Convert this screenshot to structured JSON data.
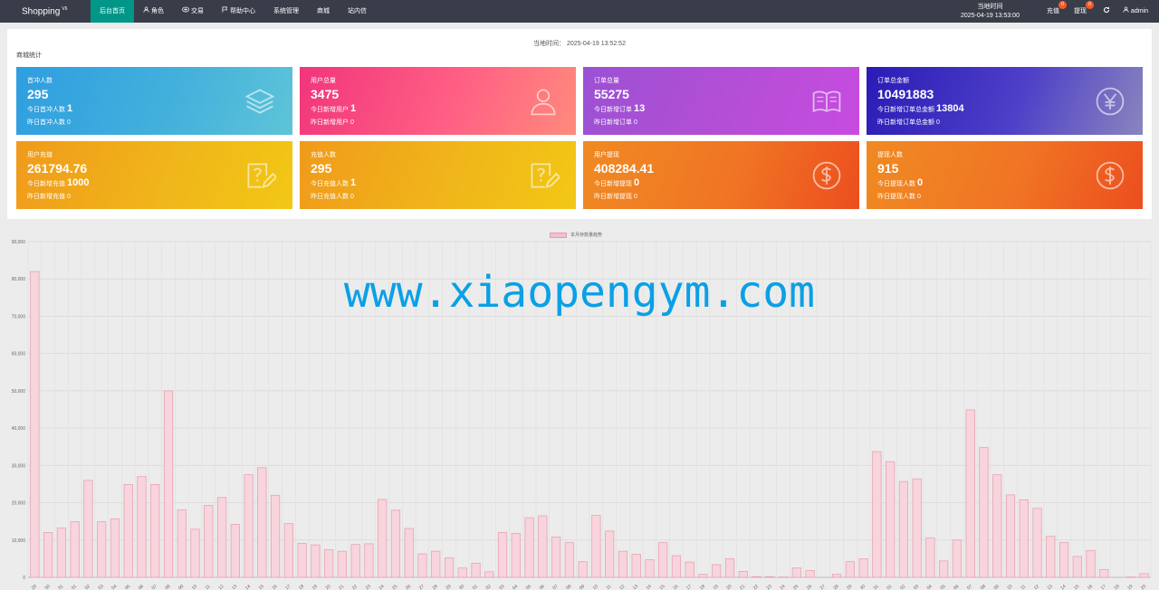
{
  "brand": {
    "name": "Shopping",
    "version": "V6"
  },
  "nav": [
    {
      "label": "后台首页",
      "icon": "",
      "active": true
    },
    {
      "label": "角色",
      "icon": "user-icon"
    },
    {
      "label": "交易",
      "icon": "transaction-icon"
    },
    {
      "label": "帮助中心",
      "icon": "flag-icon"
    },
    {
      "label": "系统管理",
      "icon": ""
    },
    {
      "label": "商城",
      "icon": ""
    },
    {
      "label": "站内信",
      "icon": ""
    }
  ],
  "header_right": {
    "time_label": "当地时间",
    "time_value": "2025-04-19 13:53:00",
    "recharge": {
      "label": "充值",
      "badge": "0"
    },
    "withdraw": {
      "label": "提现",
      "badge": "0"
    },
    "refresh_icon": "refresh-icon",
    "user": {
      "icon": "user-icon",
      "name": "admin"
    }
  },
  "panel": {
    "local_time": "当地时间：  2025-04-19 13:52:52",
    "title": "商城统计"
  },
  "cards": [
    {
      "label": "首冲人数",
      "value": "295",
      "sub1_label": "今日首冲人数",
      "sub1_value": "1",
      "sub2": "昨日首冲人数  0",
      "icon": "layers-icon",
      "style": "g-blue"
    },
    {
      "label": "用户总量",
      "value": "3475",
      "sub1_label": "今日新增用户",
      "sub1_value": "1",
      "sub2": "昨日新增用户  0",
      "icon": "users-icon",
      "style": "g-pink"
    },
    {
      "label": "订单总量",
      "value": "55275",
      "sub1_label": "今日新增订单",
      "sub1_value": "13",
      "sub2": "昨日新增订单  0",
      "icon": "book-icon",
      "style": "g-purple"
    },
    {
      "label": "订单总金额",
      "value": "10491883",
      "sub1_label": "今日新增订单总金额",
      "sub1_value": "13804",
      "sub2": "昨日新增订单总金额  0",
      "icon": "yen-icon",
      "style": "g-indigo"
    },
    {
      "label": "用户充值",
      "value": "261794.76",
      "sub1_label": "今日新增充值",
      "sub1_value": "1000",
      "sub2": "昨日新增充值  0",
      "icon": "help-edit-icon",
      "style": "g-yellow"
    },
    {
      "label": "充值人数",
      "value": "295",
      "sub1_label": "今日充值人数",
      "sub1_value": "1",
      "sub2": "昨日充值人数  0",
      "icon": "help-edit-icon",
      "style": "g-yellow"
    },
    {
      "label": "用户提现",
      "value": "408284.41",
      "sub1_label": "今日新增提现",
      "sub1_value": "0",
      "sub2": "昨日新增提现  0",
      "icon": "dollar-icon",
      "style": "g-orange"
    },
    {
      "label": "提现人数",
      "value": "915",
      "sub1_label": "今日提现人数",
      "sub1_value": "0",
      "sub2": "昨日提现人数  0",
      "icon": "dollar-icon",
      "style": "g-orange"
    }
  ],
  "watermark": "www.xiaopengym.com",
  "chart_data": {
    "type": "bar",
    "legend": "本月存款量趋势",
    "ylim": [
      0,
      90000
    ],
    "y_ticks": [
      "0",
      "10,000",
      "20,000",
      "30,000",
      "40,000",
      "50,000",
      "60,000",
      "70,000",
      "80,000",
      "90,000"
    ],
    "grid": true,
    "bar_color": "#f8d4dc",
    "bar_border": "#e8a3b4",
    "categories": [
      "29",
      "30",
      "31",
      "01",
      "02",
      "03",
      "04",
      "05",
      "06",
      "07",
      "08",
      "09",
      "10",
      "11",
      "12",
      "13",
      "14",
      "15",
      "16",
      "17",
      "18",
      "19",
      "20",
      "21",
      "22",
      "23",
      "24",
      "25",
      "26",
      "27",
      "28",
      "29",
      "30",
      "01",
      "02",
      "03",
      "04",
      "05",
      "06",
      "07",
      "08",
      "09",
      "10",
      "11",
      "12",
      "13",
      "14",
      "15",
      "16",
      "17",
      "18",
      "19",
      "20",
      "21",
      "22",
      "23",
      "24",
      "25",
      "26",
      "27",
      "28",
      "29",
      "30",
      "31",
      "01",
      "02",
      "03",
      "04",
      "05",
      "06",
      "07",
      "08",
      "09",
      "10",
      "11",
      "12",
      "13",
      "14",
      "15",
      "16",
      "17",
      "18",
      "19",
      "20",
      "08",
      "19"
    ],
    "values": [
      82000,
      12000,
      13200,
      14900,
      26000,
      14900,
      15700,
      24900,
      27000,
      24900,
      50000,
      18100,
      12900,
      19300,
      21400,
      14200,
      27500,
      29400,
      22000,
      14400,
      9100,
      8700,
      7400,
      7000,
      8800,
      9000,
      20900,
      18000,
      13100,
      6300,
      7000,
      5200,
      2500,
      3800,
      1500,
      12000,
      11800,
      16000,
      16500,
      10800,
      9300,
      4200,
      16600,
      12400,
      7000,
      6200,
      4700,
      9300,
      5800,
      4100,
      800,
      3400,
      5000,
      1600,
      200,
      200,
      100,
      2500,
      1800,
      0,
      800,
      4200,
      5000,
      33700,
      31000,
      25700,
      26400,
      10600,
      4400,
      10000,
      44900,
      34800,
      27500,
      22100,
      20800,
      18500,
      11000,
      9300,
      5600,
      7200,
      2100,
      0,
      100,
      1000
    ]
  }
}
